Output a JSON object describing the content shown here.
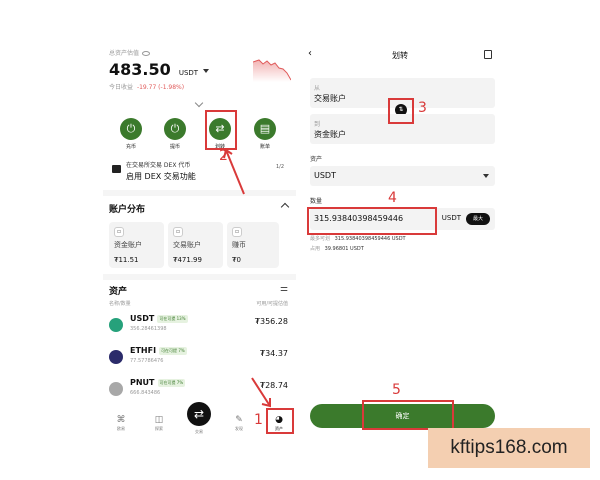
{
  "left": {
    "balance_label": "总资产估值",
    "balance_value": "483.50",
    "balance_unit": "USDT",
    "pnl_label": "今日收益",
    "pnl_value": "-19.77 (-1.98%)",
    "actions": [
      {
        "label": "充币",
        "icon": "⏻"
      },
      {
        "label": "提币",
        "icon": "⏻"
      },
      {
        "label": "划转",
        "icon": "⇄"
      },
      {
        "label": "账单",
        "icon": "▤"
      }
    ],
    "dex_banner_line1": "在交易所交易 DEX 代币",
    "dex_banner_line2": "启用 DEX 交易功能",
    "dex_banner_page": "1/2",
    "account_dist_title": "账户分布",
    "accounts": [
      {
        "name": "资金账户",
        "value": "₮11.51"
      },
      {
        "name": "交易账户",
        "value": "₮471.99"
      },
      {
        "name": "赚币",
        "value": "₮0"
      }
    ],
    "assets_title": "资产",
    "assets_col_left": "名称/数量",
    "assets_col_right": "可用/可提估值",
    "assets": [
      {
        "symbol": "USDT",
        "tag": "可在可提 13%",
        "qty": "356.28461398",
        "amount": "₮356.28",
        "color": "#26a17b"
      },
      {
        "symbol": "ETHFI",
        "tag": "可在可提 7%",
        "qty": "77.57786476",
        "amount": "₮34.37",
        "color": "#2b2b6a"
      },
      {
        "symbol": "PNUT",
        "tag": "可在可提 7%",
        "qty": "666.843486",
        "amount": "₮28.74",
        "color": "#a8a8a8"
      }
    ],
    "nav": [
      {
        "label": "欧易",
        "icon": "⌘"
      },
      {
        "label": "探索",
        "icon": "◫"
      },
      {
        "label": "交易",
        "icon": "⇄"
      },
      {
        "label": "发现",
        "icon": "✎"
      },
      {
        "label": "资产",
        "icon": "◕"
      }
    ]
  },
  "right": {
    "title": "划转",
    "from_label": "从",
    "from_value": "交易账户",
    "to_label": "到",
    "to_value": "资金账户",
    "asset_label": "资产",
    "asset_value": "USDT",
    "qty_label": "数量",
    "qty_value": "315.93840398459446",
    "qty_unit": "USDT",
    "max_label": "最大",
    "max_transferable_label": "最多可划",
    "max_transferable_value": "315.93840398459446 USDT",
    "occupied_label": "占用",
    "occupied_value": "39.96801 USDT",
    "confirm_label": "确定"
  },
  "annotations": [
    "1",
    "2",
    "3",
    "4",
    "5"
  ],
  "watermark": "kftips168.com",
  "colors": {
    "accent": "#3b7a2c",
    "annotation": "#d93a3a",
    "watermark_bg": "#f4cfb1",
    "negative": "#e05a5a"
  }
}
